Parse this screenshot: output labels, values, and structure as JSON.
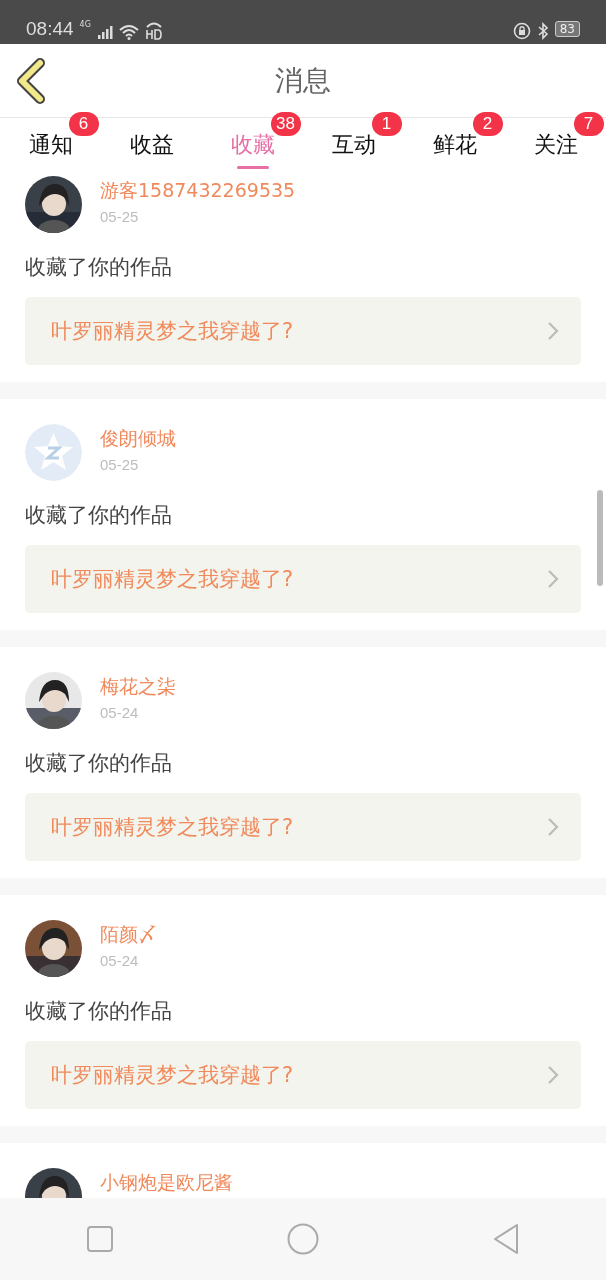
{
  "status_bar": {
    "time": "08:44",
    "network": "4G",
    "battery": "83"
  },
  "header": {
    "title": "消息"
  },
  "tabs": [
    {
      "label": "通知",
      "badge": "6",
      "selected": false
    },
    {
      "label": "收益",
      "selected": false
    },
    {
      "label": "收藏",
      "badge": "38",
      "selected": true
    },
    {
      "label": "互动",
      "badge": "1",
      "selected": false
    },
    {
      "label": "鲜花",
      "badge": "2",
      "selected": false
    },
    {
      "label": "关注",
      "badge": "7",
      "selected": false
    }
  ],
  "messages": [
    {
      "user": "游客1587432269535",
      "date": "05-25",
      "text": "收藏了你的作品",
      "work": "叶罗丽精灵梦之我穿越了?"
    },
    {
      "avatar": {
        "kind": "default"
      },
      "user": "俊朗倾城",
      "date": "05-25",
      "text": "收藏了你的作品",
      "work": "叶罗丽精灵梦之我穿越了?"
    },
    {
      "user": "梅花之柒",
      "date": "05-24",
      "text": "收藏了你的作品",
      "work": "叶罗丽精灵梦之我穿越了?"
    },
    {
      "user": "陌颜〆",
      "date": "05-24",
      "text": "收藏了你的作品",
      "work": "叶罗丽精灵梦之我穿越了?"
    },
    {
      "user": "小钢炮是欧尼酱"
    }
  ]
}
